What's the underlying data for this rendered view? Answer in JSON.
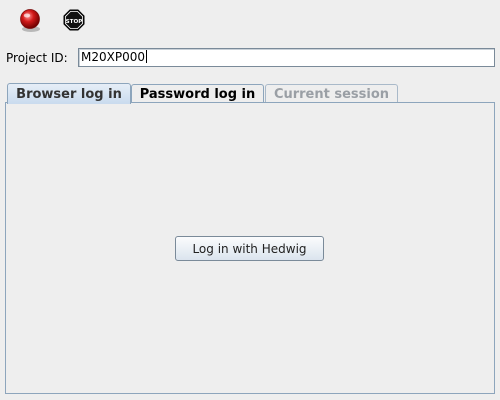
{
  "toolbar": {
    "connect_icon": "red-ball-icon",
    "stop_icon": "stop-sign-icon",
    "stop_text": "STOP"
  },
  "project": {
    "label": "Project ID:",
    "value": "M20XP000"
  },
  "tabs": [
    {
      "label": "Browser log in",
      "state": "selected"
    },
    {
      "label": "Password log in",
      "state": "enabled"
    },
    {
      "label": "Current session",
      "state": "disabled"
    }
  ],
  "browser_tab": {
    "login_button": "Log in with Hedwig"
  },
  "colors": {
    "background": "#eeeeee",
    "tab_border": "#8da5bc",
    "disabled_text": "#9a9fa5",
    "connect_red": "#cc1111"
  }
}
